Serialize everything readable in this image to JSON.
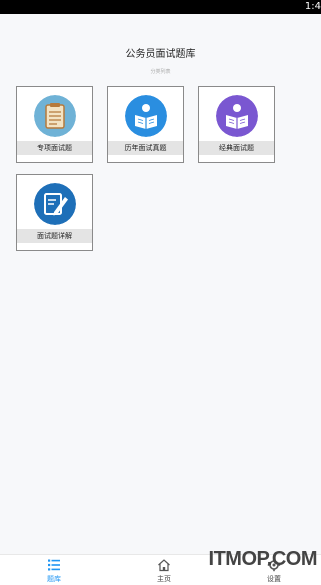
{
  "status_bar": {
    "time": "1:4"
  },
  "header": {
    "title": "公务员面试题库",
    "subtitle": "分类列表"
  },
  "categories": [
    {
      "label": "专项面试题",
      "icon": "clipboard-icon",
      "color": "#6fb2d6"
    },
    {
      "label": "历年面试真题",
      "icon": "reader-book-icon",
      "color": "#2a8ee0"
    },
    {
      "label": "经典面试题",
      "icon": "reader-book-icon",
      "color": "#7a57d1"
    },
    {
      "label": "面试题详解",
      "icon": "edit-pen-icon",
      "color": "#1e6fb8"
    }
  ],
  "tab_bar": {
    "items": [
      {
        "label": "题库",
        "icon": "list-icon",
        "active": true
      },
      {
        "label": "主页",
        "icon": "home-icon",
        "active": false
      },
      {
        "label": "设置",
        "icon": "gear-icon",
        "active": false
      }
    ]
  },
  "watermark": "ITMOP.COM",
  "colors": {
    "accent": "#2196f3",
    "background": "#f7f8fa"
  }
}
